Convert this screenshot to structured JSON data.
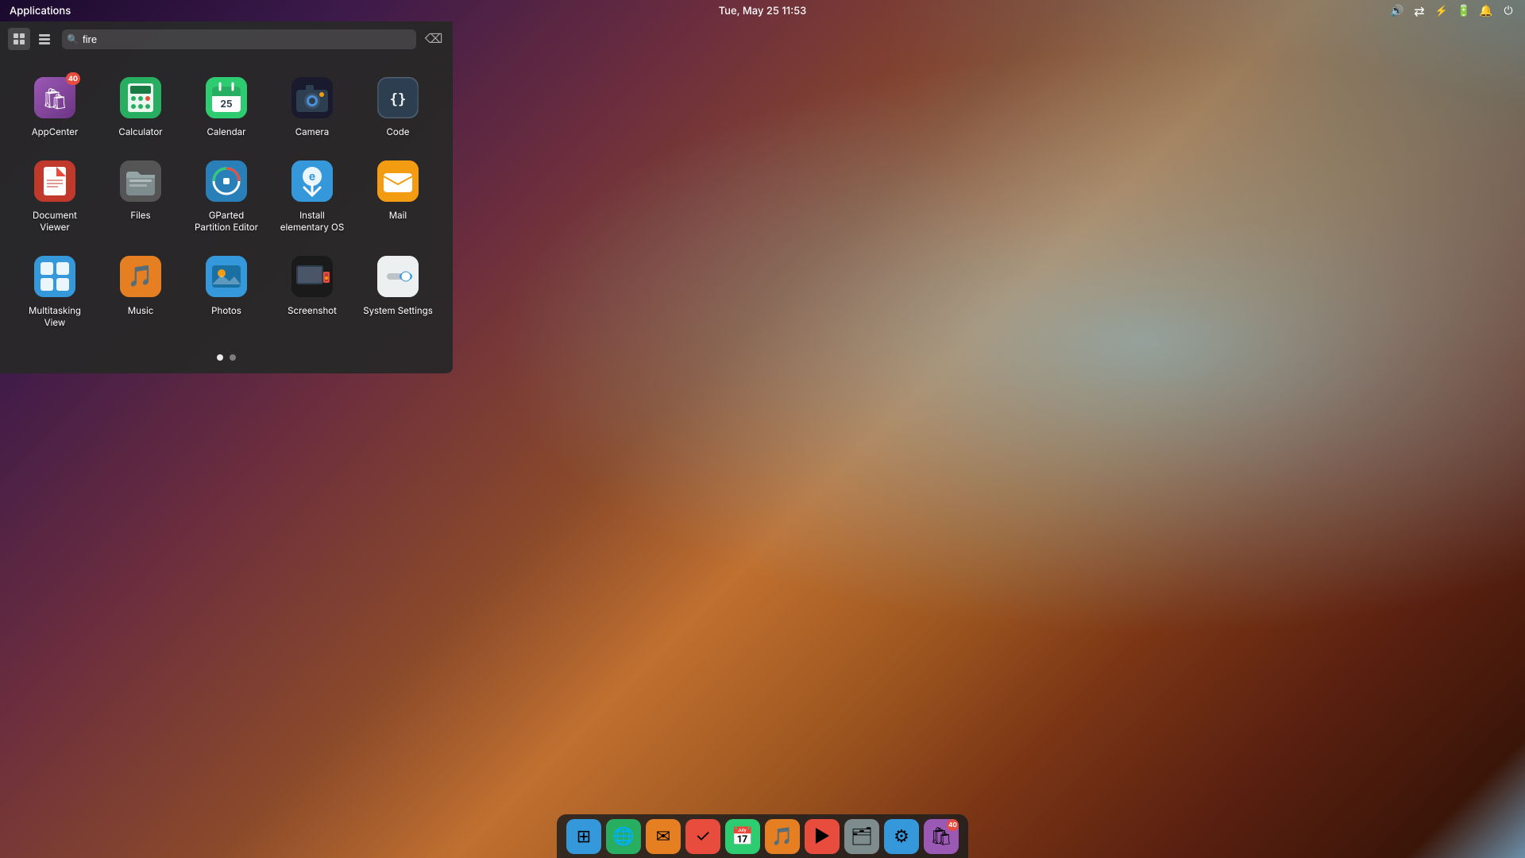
{
  "topPanel": {
    "appMenu": "Applications",
    "dateTime": "Tue, May 25   11:53",
    "icons": {
      "volume": "🔊",
      "network": "⇄",
      "bluetooth": "⚡",
      "battery": "🔋",
      "notification": "🔔",
      "power": "⏻"
    }
  },
  "launcher": {
    "searchPlaceholder": "fire",
    "clearButton": "⌫",
    "viewModes": [
      "grid-view",
      "list-view"
    ],
    "apps": [
      {
        "id": "appcenter",
        "label": "AppCenter",
        "badge": "40",
        "iconClass": "icon-appcenter",
        "emoji": "🛍"
      },
      {
        "id": "calculator",
        "label": "Calculator",
        "iconClass": "icon-calculator",
        "emoji": "🧮"
      },
      {
        "id": "calendar",
        "label": "Calendar",
        "iconClass": "icon-calendar",
        "emoji": "📅"
      },
      {
        "id": "camera",
        "label": "Camera",
        "iconClass": "icon-camera",
        "emoji": "📷"
      },
      {
        "id": "code",
        "label": "Code",
        "iconClass": "icon-code",
        "emoji": "{}"
      },
      {
        "id": "document-viewer",
        "label": "Document Viewer",
        "iconClass": "icon-docviewer",
        "emoji": "📄"
      },
      {
        "id": "files",
        "label": "Files",
        "iconClass": "icon-files",
        "emoji": "🗂"
      },
      {
        "id": "gparted",
        "label": "GParted Partition Editor",
        "iconClass": "icon-gparted",
        "emoji": "💾"
      },
      {
        "id": "install-elementary",
        "label": "Install elementary OS",
        "iconClass": "icon-install-eos",
        "emoji": "⬇"
      },
      {
        "id": "mail",
        "label": "Mail",
        "iconClass": "icon-mail",
        "emoji": "✉"
      },
      {
        "id": "multitasking",
        "label": "Multitasking View",
        "iconClass": "icon-multitasking",
        "emoji": "⊞"
      },
      {
        "id": "music",
        "label": "Music",
        "iconClass": "icon-music",
        "emoji": "🎵"
      },
      {
        "id": "photos",
        "label": "Photos",
        "iconClass": "icon-photos",
        "emoji": "🖼"
      },
      {
        "id": "screenshot",
        "label": "Screenshot",
        "iconClass": "icon-screenshot",
        "emoji": "📸"
      },
      {
        "id": "system-settings",
        "label": "System Settings",
        "iconClass": "icon-sysset",
        "emoji": "⚙"
      }
    ],
    "pageIndicators": [
      {
        "active": true
      },
      {
        "active": false
      }
    ]
  },
  "dock": {
    "items": [
      {
        "id": "multitasking-dock",
        "emoji": "⊞",
        "bg": "#3498db"
      },
      {
        "id": "browser-dock",
        "emoji": "🌐",
        "bg": "#27ae60"
      },
      {
        "id": "mail-dock",
        "emoji": "✉",
        "bg": "#e67e22"
      },
      {
        "id": "tasks-dock",
        "emoji": "✓",
        "bg": "#e74c3c"
      },
      {
        "id": "calendar-dock",
        "emoji": "📅",
        "bg": "#2ecc71"
      },
      {
        "id": "music-dock",
        "emoji": "🎵",
        "bg": "#e67e22"
      },
      {
        "id": "media-dock",
        "emoji": "▶",
        "bg": "#e74c3c"
      },
      {
        "id": "files-dock",
        "emoji": "🗂",
        "bg": "#7f8c8d"
      },
      {
        "id": "settings-dock",
        "emoji": "⚙",
        "bg": "#3498db"
      },
      {
        "id": "appcenter-dock",
        "emoji": "🛍",
        "bg": "#9b59b6",
        "badge": "40"
      }
    ]
  }
}
